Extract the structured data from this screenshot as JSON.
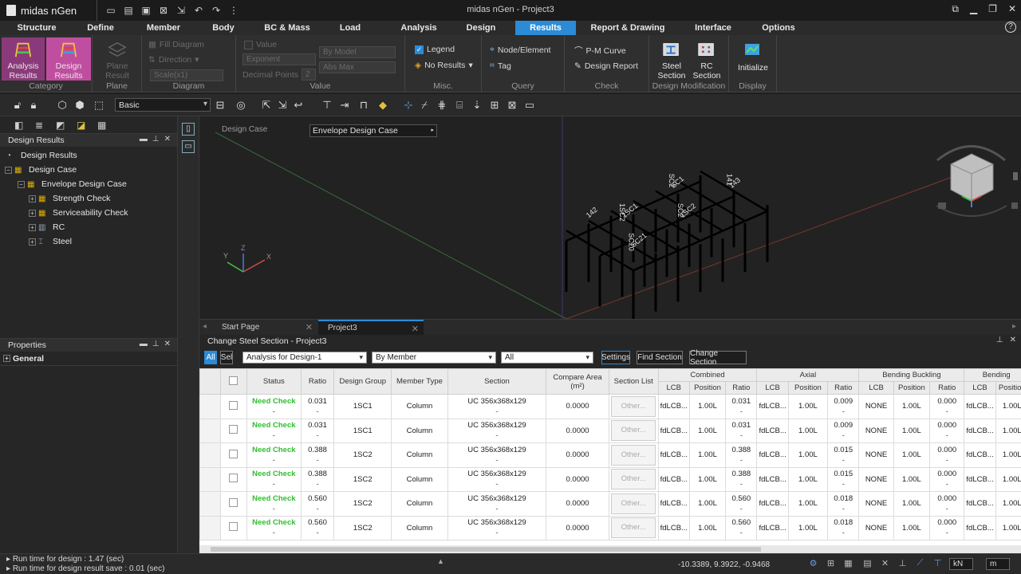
{
  "app": {
    "logo": "midas nGen",
    "window_title": "midas nGen - Project3"
  },
  "menu": [
    "Structure",
    "Define",
    "Member",
    "Body",
    "BC & Mass",
    "Load",
    "Analysis",
    "Design",
    "Results",
    "Report & Drawing",
    "Interface",
    "Options"
  ],
  "ribbon": {
    "category": {
      "label": "Category",
      "analysis": "Analysis\nResults",
      "design": "Design\nResults"
    },
    "plane": {
      "label": "Plane",
      "btn": "Plane\nResult"
    },
    "diagram": {
      "label": "Diagram",
      "fill": "Fill Diagram",
      "direction": "Direction",
      "scale": "Scale(x1)"
    },
    "value": {
      "label": "Value",
      "value": "Value",
      "exponent": "Exponent",
      "by_model": "By Model",
      "abs_max": "Abs Max",
      "decimal_points": "Decimal Points",
      "decimal_value": "2"
    },
    "misc": {
      "label": "Misc.",
      "legend": "Legend",
      "no_results": "No Results"
    },
    "query": {
      "label": "Query",
      "node_element": "Node/Element",
      "tag": "Tag"
    },
    "check": {
      "label": "Check",
      "pm_curve": "P-M Curve",
      "design_report": "Design Report"
    },
    "design_mod": {
      "label": "Design Modification",
      "steel": "Steel\nSection",
      "rc": "RC\nSection"
    },
    "display": {
      "label": "Display",
      "initialize": "Initialize"
    }
  },
  "toolbar": {
    "view_mode": "Basic"
  },
  "left": {
    "panel_title": "Design Results",
    "tree": [
      {
        "label": "Design Results",
        "depth": 0
      },
      {
        "label": "Design Case",
        "depth": 0
      },
      {
        "label": "Envelope Design Case",
        "depth": 1
      },
      {
        "label": "Strength Check",
        "depth": 2
      },
      {
        "label": "Serviceability Check",
        "depth": 2
      },
      {
        "label": "RC",
        "depth": 2
      },
      {
        "label": "Steel",
        "depth": 2
      }
    ],
    "properties_title": "Properties",
    "properties_group": "General"
  },
  "viewport": {
    "design_case_label": "Design Case",
    "design_case_value": "Envelope Design Case",
    "model_labels": [
      "SC21",
      "SC20",
      "1SC1",
      "1SC2",
      "1SC2",
      "SC2",
      "SC1",
      "SC2",
      "143",
      "141",
      "142"
    ]
  },
  "tabs": [
    {
      "label": "Start Page"
    },
    {
      "label": "Project3"
    }
  ],
  "bottom": {
    "title": "Change Steel Section - Project3",
    "btn_all": "All",
    "btn_sel": "Sel",
    "dd_design": "Analysis for Design-1",
    "dd_by": "By Member",
    "dd_filter": "All",
    "btn_settings": "Settings",
    "btn_find": "Find Section",
    "btn_change": "Change Section",
    "headers": {
      "status": "Status",
      "ratio": "Ratio",
      "design_group": "Design Group",
      "member_type": "Member Type",
      "section": "Section",
      "compare_area": "Compare Area\n(m²)",
      "section_list": "Section List",
      "combined": "Combined",
      "axial": "Axial",
      "bending_buckling": "Bending Buckling",
      "bending": "Bending",
      "lcb": "LCB",
      "position": "Position",
      "ratio_sub": "Ratio"
    },
    "rows": [
      {
        "status": "Need Check",
        "ratio": "0.031",
        "group": "1SC1",
        "type": "Column",
        "section": "UC 356x368x129",
        "area": "0.0000",
        "list": "Other...",
        "c_lcb": "fdLCB...",
        "c_pos": "1.00L",
        "c_ratio": "0.031",
        "a_lcb": "fdLCB...",
        "a_pos": "1.00L",
        "a_ratio": "0.009",
        "bb_lcb": "NONE",
        "bb_pos": "1.00L",
        "bb_ratio": "0.000",
        "b_lcb": "fdLCB...",
        "b_pos": "1.00L"
      },
      {
        "status": "Need Check",
        "ratio": "0.031",
        "group": "1SC1",
        "type": "Column",
        "section": "UC 356x368x129",
        "area": "0.0000",
        "list": "Other...",
        "c_lcb": "fdLCB...",
        "c_pos": "1.00L",
        "c_ratio": "0.031",
        "a_lcb": "fdLCB...",
        "a_pos": "1.00L",
        "a_ratio": "0.009",
        "bb_lcb": "NONE",
        "bb_pos": "1.00L",
        "bb_ratio": "0.000",
        "b_lcb": "fdLCB...",
        "b_pos": "1.00L"
      },
      {
        "status": "Need Check",
        "ratio": "0.388",
        "group": "1SC2",
        "type": "Column",
        "section": "UC 356x368x129",
        "area": "0.0000",
        "list": "Other...",
        "c_lcb": "fdLCB...",
        "c_pos": "1.00L",
        "c_ratio": "0.388",
        "a_lcb": "fdLCB...",
        "a_pos": "1.00L",
        "a_ratio": "0.015",
        "bb_lcb": "NONE",
        "bb_pos": "1.00L",
        "bb_ratio": "0.000",
        "b_lcb": "fdLCB...",
        "b_pos": "1.00L"
      },
      {
        "status": "Need Check",
        "ratio": "0.388",
        "group": "1SC2",
        "type": "Column",
        "section": "UC 356x368x129",
        "area": "0.0000",
        "list": "Other...",
        "c_lcb": "fdLCB...",
        "c_pos": "1.00L",
        "c_ratio": "0.388",
        "a_lcb": "fdLCB...",
        "a_pos": "1.00L",
        "a_ratio": "0.015",
        "bb_lcb": "NONE",
        "bb_pos": "1.00L",
        "bb_ratio": "0.000",
        "b_lcb": "fdLCB...",
        "b_pos": "1.00L"
      },
      {
        "status": "Need Check",
        "ratio": "0.560",
        "group": "1SC2",
        "type": "Column",
        "section": "UC 356x368x129",
        "area": "0.0000",
        "list": "Other...",
        "c_lcb": "fdLCB...",
        "c_pos": "1.00L",
        "c_ratio": "0.560",
        "a_lcb": "fdLCB...",
        "a_pos": "1.00L",
        "a_ratio": "0.018",
        "bb_lcb": "NONE",
        "bb_pos": "1.00L",
        "bb_ratio": "0.000",
        "b_lcb": "fdLCB...",
        "b_pos": "1.00L"
      },
      {
        "status": "Need Check",
        "ratio": "0.560",
        "group": "1SC2",
        "type": "Column",
        "section": "UC 356x368x129",
        "area": "0.0000",
        "list": "Other...",
        "c_lcb": "fdLCB...",
        "c_pos": "1.00L",
        "c_ratio": "0.560",
        "a_lcb": "fdLCB...",
        "a_pos": "1.00L",
        "a_ratio": "0.018",
        "bb_lcb": "NONE",
        "bb_pos": "1.00L",
        "bb_ratio": "0.000",
        "b_lcb": "fdLCB...",
        "b_pos": "1.00L"
      }
    ]
  },
  "status": {
    "msg1": "Run time for design : 1.47 (sec)",
    "msg2": "Run time for design result save : 0.01 (sec)",
    "coords": "-10.3389, 9.3922, -0.9468",
    "unit_force": "kN",
    "unit_length": "m"
  }
}
